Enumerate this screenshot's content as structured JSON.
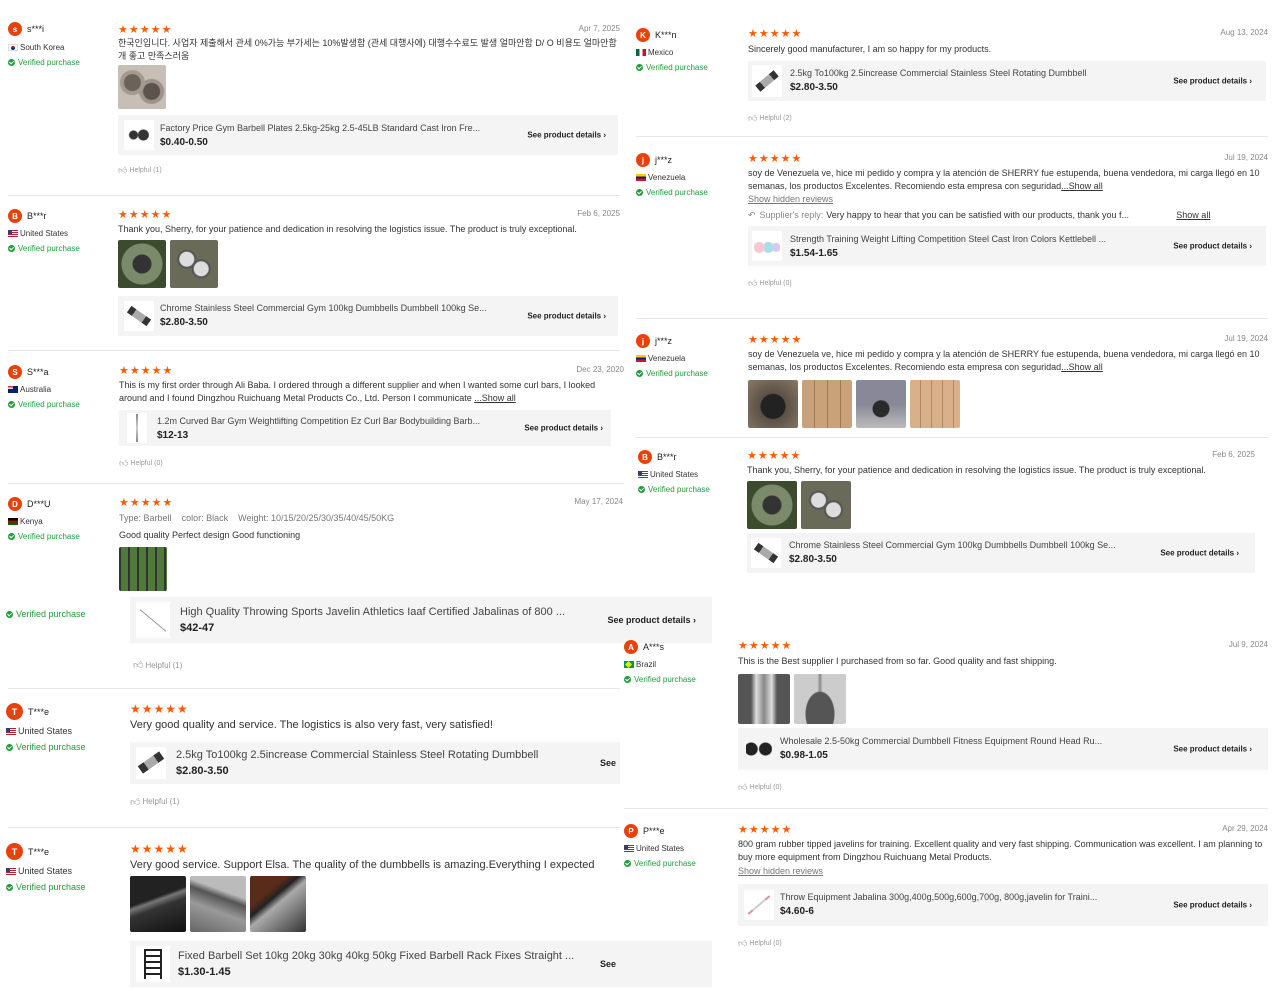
{
  "colors": {
    "star": "#ff5a00",
    "verified": "#1f9d3b",
    "avatar": "#e8410a"
  },
  "common": {
    "stars": "★★★★★",
    "verified_label": "Verified purchase",
    "see_details": "See product details",
    "see_details_cut": "See",
    "show_all": "...Show all",
    "show_all_short": "Show all",
    "show_hidden": "Show hidden reviews",
    "supplier_reply_label": "Supplier's reply:"
  },
  "left": [
    {
      "initial": "s",
      "name": "s***i",
      "country": "South Korea",
      "flag": "kr",
      "date": "Apr 7, 2025",
      "text": "한국인입니다. 사업자 제출해서 관세 0%가능 부가세는 10%발생함 (관세 대행사에) 대행수수료도 발생 얼마안함 D/ O 비용도 얼마안함 개 좋고 만족스러움",
      "product": "Factory Price Gym Barbell Plates 2.5kg-25kg 2.5-45LB Standard Cast Iron Fre...",
      "price": "$0.40-0.50",
      "helpful": "Helpful (1)"
    },
    {
      "initial": "B",
      "name": "B***r",
      "country": "United States",
      "flag": "us",
      "date": "Feb 6, 2025",
      "text": "Thank you, Sherry, for your patience and dedication in resolving the logistics issue. The product is truly exceptional.",
      "product": "Chrome Stainless Steel Commercial Gym 100kg Dumbbells Dumbbell 100kg Se...",
      "price": "$2.80-3.50"
    },
    {
      "initial": "S",
      "name": "S***a",
      "country": "Australia",
      "flag": "au",
      "date": "Dec 23, 2020",
      "text": "This is my first order through Ali Baba. I ordered through a different supplier and when I wanted some curl bars, I looked around and I found Dingzhou Ruichuang Metal Products Co., Ltd. Person I communicate",
      "product": "1.2m Curved Bar Gym Weightlifting Competition Ez Curl Bar Bodybuilding Barb...",
      "price": "$12-13",
      "helpful": "Helpful (0)"
    },
    {
      "initial": "D",
      "name": "D***U",
      "country": "Kenya",
      "flag": "ke",
      "date": "May 17, 2024",
      "attrs": [
        {
          "k": "Type:",
          "v": "Barbell"
        },
        {
          "k": "color:",
          "v": "Black"
        },
        {
          "k": "Weight:",
          "v": "10/15/20/25/30/35/40/45/50KG"
        }
      ],
      "text": "Good quality Perfect design Good functioning",
      "product": "High Quality Throwing Sports Javelin Athletics Iaaf Certified Jabalinas of 800 ...",
      "price": "$42-47",
      "helpful": "Helpful (1)"
    },
    {
      "initial": "T",
      "name": "T***e",
      "country": "United States",
      "flag": "us",
      "text": "Very good quality and service. The logistics is also very fast, very satisfied!",
      "product": "2.5kg To100kg 2.5increase Commercial Stainless Steel Rotating Dumbbell",
      "price": "$2.80-3.50",
      "helpful": "Helpful (1)"
    },
    {
      "initial": "T",
      "name": "T***e",
      "country": "United States",
      "flag": "us",
      "text": "Very good service. Support Elsa. The quality of the dumbbells is amazing.Everything I expected",
      "product": "Fixed Barbell Set 10kg 20kg 30kg 40kg 50kg Fixed Barbell Rack Fixes Straight ...",
      "price": "$1.30-1.45"
    }
  ],
  "right": [
    {
      "initial": "K",
      "name": "K***n",
      "country": "Mexico",
      "flag": "mx",
      "date": "Aug 13, 2024",
      "text": "Sincerely good manufacturer, I am so happy for my products.",
      "product": "2.5kg To100kg 2.5increase Commercial Stainless Steel Rotating Dumbbell",
      "price": "$2.80-3.50",
      "helpful": "Helpful (2)"
    },
    {
      "initial": "j",
      "name": "j***z",
      "country": "Venezuela",
      "flag": "ve",
      "date": "Jul 19, 2024",
      "text": "soy de Venezuela ve, hice mi pedido y compra y la atención de SHERRY fue estupenda, buena vendedora, mi carga llegó en 10 semanas, los productos Excelentes. Recomiendo esta empresa con seguridad",
      "reply": "Very happy to hear that you can be satisfied with our products, thank you f...",
      "product": "Strength Training Weight Lifting Competition Steel Cast Iron Colors Kettlebell ...",
      "price": "$1.54-1.65",
      "helpful": "Helpful (0)"
    },
    {
      "initial": "j",
      "name": "j***z",
      "country": "Venezuela",
      "flag": "ve",
      "date": "Jul 19, 2024",
      "text": "soy de Venezuela ve, hice mi pedido y compra y la atención de SHERRY fue estupenda, buena vendedora, mi carga llegó en 10 semanas, los productos Excelentes. Recomiendo esta empresa con seguridad"
    },
    {
      "initial": "B",
      "name": "B***r",
      "country": "United States",
      "flag": "us",
      "date": "Feb 6, 2025",
      "text": "Thank you, Sherry, for your patience and dedication in resolving the logistics issue. The product is truly exceptional.",
      "product": "Chrome Stainless Steel Commercial Gym 100kg Dumbbells Dumbbell 100kg Se...",
      "price": "$2.80-3.50"
    },
    {
      "initial": "A",
      "name": "A***s",
      "country": "Brazil",
      "flag": "br",
      "date": "Jul 9, 2024",
      "text": "This is the Best supplier I purchased from so far. Good quality and fast shipping.",
      "product": "Wholesale 2.5-50kg Commercial Dumbbell Fitness Equipment Round Head Ru...",
      "price": "$0.98-1.05",
      "helpful": "Helpful (0)"
    },
    {
      "initial": "P",
      "name": "P***e",
      "country": "United States",
      "flag": "us",
      "date": "Apr 29, 2024",
      "text": "800 gram rubber tipped javelins for training. Excellent quality and very fast shipping. Communication was excellent. I am planning to buy more equipment from Dingzhou Ruichuang Metal Products.",
      "product": "Throw Equipment Jabalina 300g,400g,500g,600g,700g, 800g,javelin for Traini...",
      "price": "$4.60-6",
      "helpful": "Helpful (0)"
    }
  ],
  "orphan_verified": "Verified purchase"
}
